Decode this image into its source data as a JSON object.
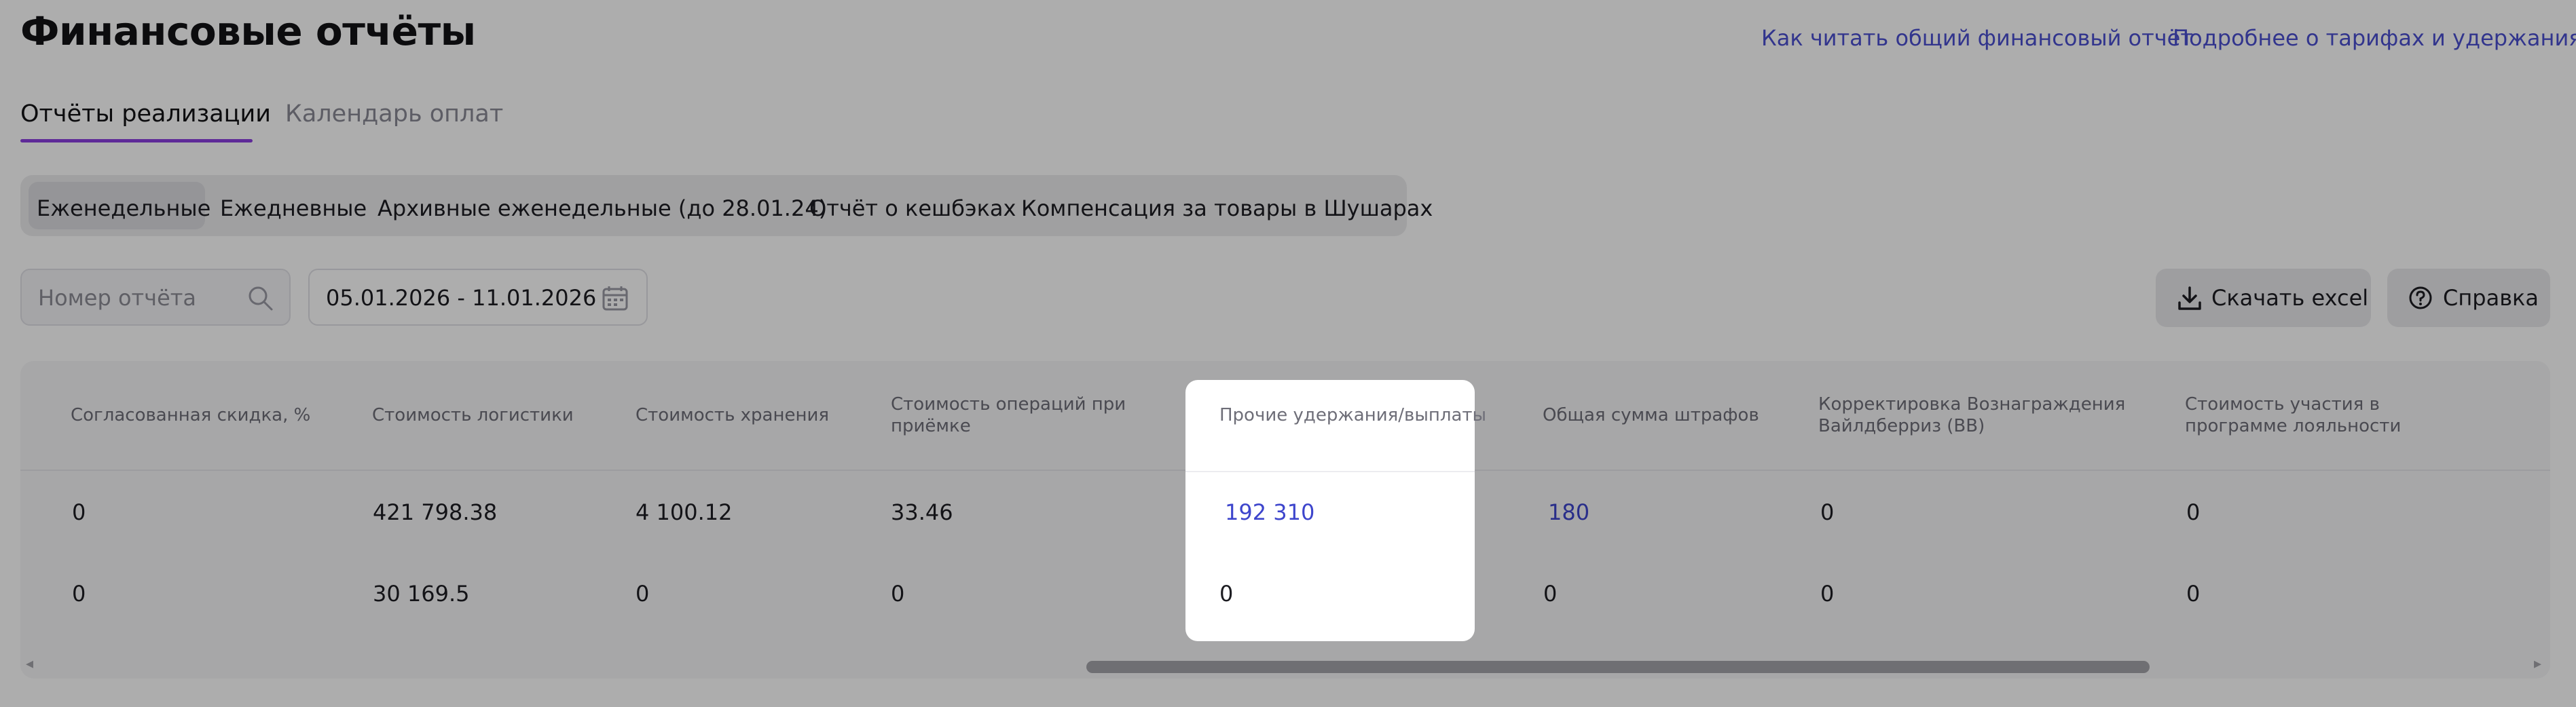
{
  "page": {
    "title": "Финансовые отчёты",
    "links": [
      "Как читать общий финансовый отчёт",
      "Подробнее о тарифах и удержаниях"
    ]
  },
  "tabs": [
    {
      "label": "Отчёты реализации",
      "active": true
    },
    {
      "label": "Календарь оплат",
      "active": false
    }
  ],
  "segments": [
    {
      "label": "Еженедельные",
      "active": true
    },
    {
      "label": "Ежедневные"
    },
    {
      "label": "Архивные еженедельные (до 28.01.24)"
    },
    {
      "label": "Отчёт о кешбэках"
    },
    {
      "label": "Компенсация за товары в Шушарах"
    }
  ],
  "filters": {
    "report_number_placeholder": "Номер отчёта",
    "date_range": "05.01.2026 - 11.01.2026"
  },
  "actions": {
    "download": "Скачать excel",
    "help": "Справка"
  },
  "table": {
    "columns": [
      "Согласованная скидка, %",
      "Стоимость логистики",
      "Стоимость хранения",
      "Стоимость операций при приёмке",
      "Прочие удержания/выплаты",
      "Общая сумма штрафов",
      "Корректировка Вознаграждения Вайлдберриз (ВВ)",
      "Стоимость участия в программе лояльности"
    ],
    "rows": [
      [
        "0",
        "421 798.38",
        "4 100.12",
        "33.46",
        "192 310",
        "180",
        "0",
        "0"
      ],
      [
        "0",
        "30 169.5",
        "0",
        "0",
        "0",
        "0",
        "0",
        "0"
      ]
    ]
  },
  "colors": {
    "accent": "#8b3ee0",
    "link": "#4a4fd0",
    "overlay": "rgba(0,0,0,0.32)"
  },
  "icons": [
    "search-icon",
    "calendar-icon",
    "download-icon",
    "help-circle-icon",
    "arrow-left-icon",
    "arrow-right-icon"
  ]
}
